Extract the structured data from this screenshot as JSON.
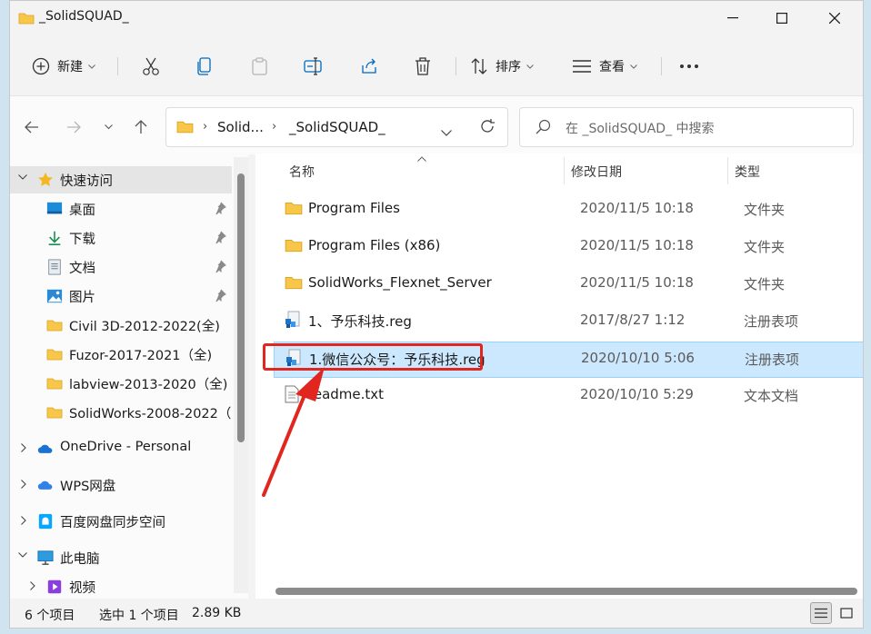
{
  "window": {
    "title": "_SolidSQUAD_"
  },
  "toolbar": {
    "new_label": "新建",
    "sort_label": "排序",
    "view_label": "查看",
    "more_label": "···"
  },
  "address": {
    "crumb1": "Solid...",
    "crumb2": "_SolidSQUAD_"
  },
  "search": {
    "placeholder": "在 _SolidSQUAD_ 中搜索"
  },
  "sidebar": {
    "quick_access": "快速访问",
    "items": [
      {
        "label": "桌面"
      },
      {
        "label": "下载"
      },
      {
        "label": "文档"
      },
      {
        "label": "图片"
      },
      {
        "label": "Civil 3D-2012-2022(全)"
      },
      {
        "label": "Fuzor-2017-2021（全)"
      },
      {
        "label": "labview-2013-2020（全)"
      },
      {
        "label": "SolidWorks-2008-2022（"
      }
    ],
    "onedrive": "OneDrive - Personal",
    "wps": "WPS网盘",
    "baidu": "百度网盘同步空间",
    "this_pc": "此电脑",
    "videos": "视频"
  },
  "columns": {
    "name": "名称",
    "date": "修改日期",
    "type": "类型"
  },
  "files": [
    {
      "name": "Program Files",
      "date": "2020/11/5 10:18",
      "type": "文件夹"
    },
    {
      "name": "Program Files (x86)",
      "date": "2020/11/5 10:18",
      "type": "文件夹"
    },
    {
      "name": "SolidWorks_Flexnet_Server",
      "date": "2020/11/5 10:18",
      "type": "文件夹"
    },
    {
      "name": "1、予乐科技.reg",
      "date": "2017/8/27 1:12",
      "type": "注册表项"
    },
    {
      "name": "1.微信公众号：予乐科技.reg",
      "date": "2020/10/10 5:06",
      "type": "注册表项"
    },
    {
      "name": "readme.txt",
      "date": "2020/10/10 5:29",
      "type": "文本文档"
    }
  ],
  "status": {
    "count": "6 个项目",
    "selection": "选中 1 个项目",
    "size": "2.89 KB"
  },
  "colors": {
    "selection": "#cce8ff",
    "accent": "#0067c0",
    "annotation": "#e0261f",
    "folder": "#f8c74a"
  }
}
